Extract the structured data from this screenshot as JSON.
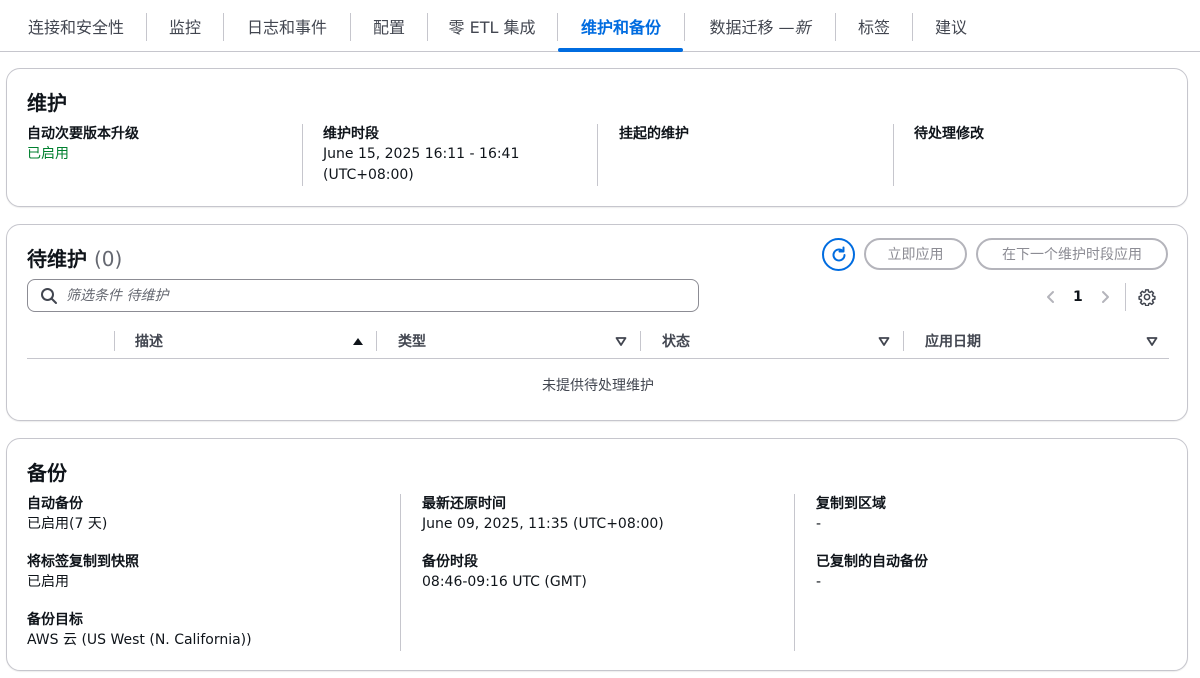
{
  "tabs": [
    {
      "label": "连接和安全性"
    },
    {
      "label": "监控"
    },
    {
      "label": "日志和事件"
    },
    {
      "label": "配置"
    },
    {
      "label": "零 ETL 集成"
    },
    {
      "label": "维护和备份"
    },
    {
      "label": "数据迁移 — ",
      "suffix": "新"
    },
    {
      "label": "标签"
    },
    {
      "label": "建议"
    }
  ],
  "active_tab": "维护和备份",
  "maintenance": {
    "title": "维护",
    "auto_minor_label": "自动次要版本升级",
    "auto_minor_value": "已启用",
    "window_label": "维护时段",
    "window_value_line1": "June 15, 2025 16:11 - 16:41",
    "window_value_line2": "(UTC+08:00)",
    "pending_maint_label": "挂起的维护",
    "pending_mod_label": "待处理修改"
  },
  "pending": {
    "title": "待维护",
    "count": "(0)",
    "apply_now": "立即应用",
    "apply_next": "在下一个维护时段应用",
    "search_placeholder": "筛选条件 待维护",
    "page": "1",
    "columns": [
      "描述",
      "类型",
      "状态",
      "应用日期"
    ],
    "empty": "未提供待处理维护"
  },
  "backup": {
    "title": "备份",
    "auto_backup_label": "自动备份",
    "auto_backup_value": "已启用(7 天)",
    "copy_tags_label": "将标签复制到快照",
    "copy_tags_value": "已启用",
    "target_label": "备份目标",
    "target_value": "AWS 云 (US West (N. California))",
    "latest_restore_label": "最新还原时间",
    "latest_restore_value": "June 09, 2025, 11:35 (UTC+08:00)",
    "window_label": "备份时段",
    "window_value": "08:46-09:16 UTC (GMT)",
    "replicate_region_label": "复制到区域",
    "replicate_region_value": "-",
    "replicated_auto_label": "已复制的自动备份",
    "replicated_auto_value": "-"
  },
  "colors": {
    "accent": "#006ce0",
    "enabled": "#00802f",
    "border": "#c6c6cd"
  }
}
